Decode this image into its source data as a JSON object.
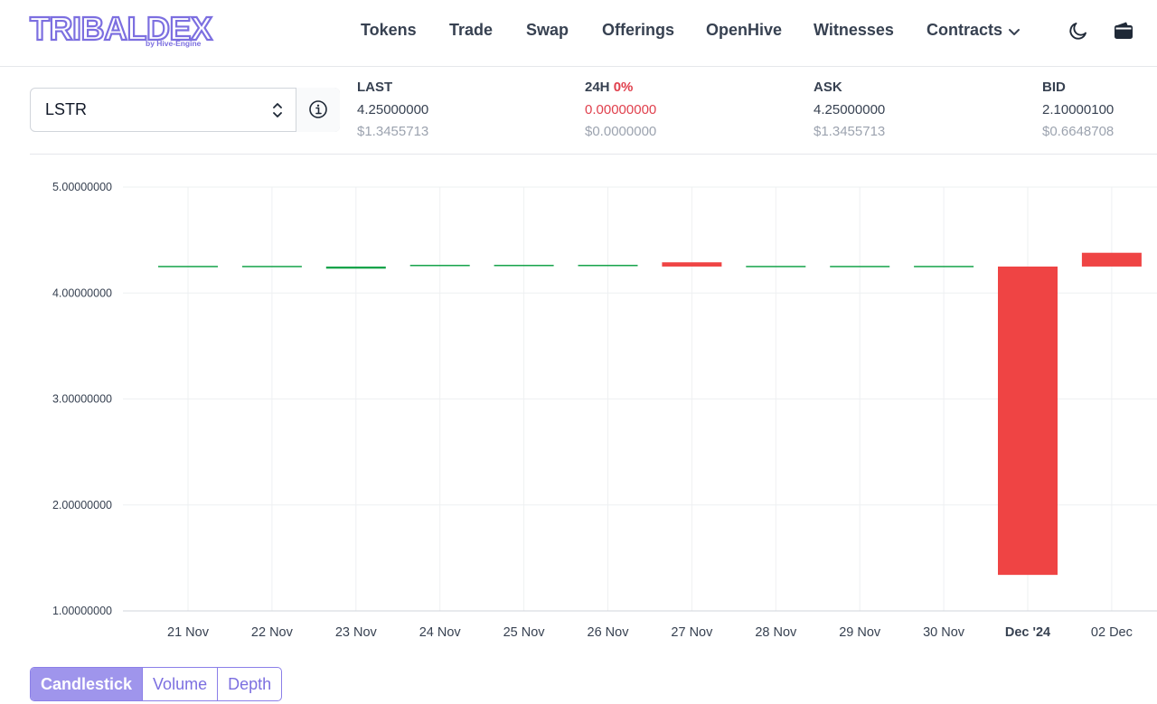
{
  "header": {
    "logo_text": "TRIBALDEX",
    "logo_sub": "by Hive-Engine",
    "nav": [
      "Tokens",
      "Trade",
      "Swap",
      "Offerings",
      "OpenHive",
      "Witnesses",
      "Contracts"
    ],
    "icons": [
      "moon-icon",
      "wallet-icon"
    ]
  },
  "token": {
    "selected": "LSTR"
  },
  "stats": {
    "last": {
      "label": "LAST",
      "value": "4.25000000",
      "usd": "$1.3455713"
    },
    "change": {
      "label": "24H",
      "pct": "0%",
      "value": "0.00000000",
      "usd": "$0.0000000"
    },
    "ask": {
      "label": "ASK",
      "value": "4.25000000",
      "usd": "$1.3455713"
    },
    "bid": {
      "label": "BID",
      "value": "2.10000100",
      "usd": "$0.6648708"
    }
  },
  "colors": {
    "accent": "#7c6fe0",
    "up": "#16a34a",
    "down": "#ef4444",
    "grid": "#eef0f2"
  },
  "chart_data": {
    "type": "candlestick",
    "y_ticks": [
      "5.00000000",
      "4.00000000",
      "3.00000000",
      "2.00000000",
      "1.00000000"
    ],
    "ylim": [
      1,
      5
    ],
    "grid": true,
    "candles": [
      {
        "x": "21 Nov",
        "open": 4.25,
        "close": 4.25,
        "dir": "up"
      },
      {
        "x": "22 Nov",
        "open": 4.25,
        "close": 4.25,
        "dir": "up"
      },
      {
        "x": "23 Nov",
        "open": 4.23,
        "close": 4.25,
        "dir": "up"
      },
      {
        "x": "24 Nov",
        "open": 4.25,
        "close": 4.26,
        "dir": "up"
      },
      {
        "x": "25 Nov",
        "open": 4.25,
        "close": 4.26,
        "dir": "up"
      },
      {
        "x": "26 Nov",
        "open": 4.25,
        "close": 4.26,
        "dir": "up"
      },
      {
        "x": "27 Nov",
        "open": 4.29,
        "close": 4.25,
        "dir": "down"
      },
      {
        "x": "28 Nov",
        "open": 4.25,
        "close": 4.25,
        "dir": "up"
      },
      {
        "x": "29 Nov",
        "open": 4.25,
        "close": 4.25,
        "dir": "up"
      },
      {
        "x": "30 Nov",
        "open": 4.25,
        "close": 4.25,
        "dir": "up"
      },
      {
        "x": "Dec '24",
        "open": 4.25,
        "close": 1.34,
        "dir": "down",
        "bold": true
      },
      {
        "x": "02 Dec",
        "open": 4.38,
        "close": 4.25,
        "dir": "down"
      }
    ]
  },
  "tabs": {
    "items": [
      "Candlestick",
      "Volume",
      "Depth"
    ],
    "active": "Candlestick"
  }
}
